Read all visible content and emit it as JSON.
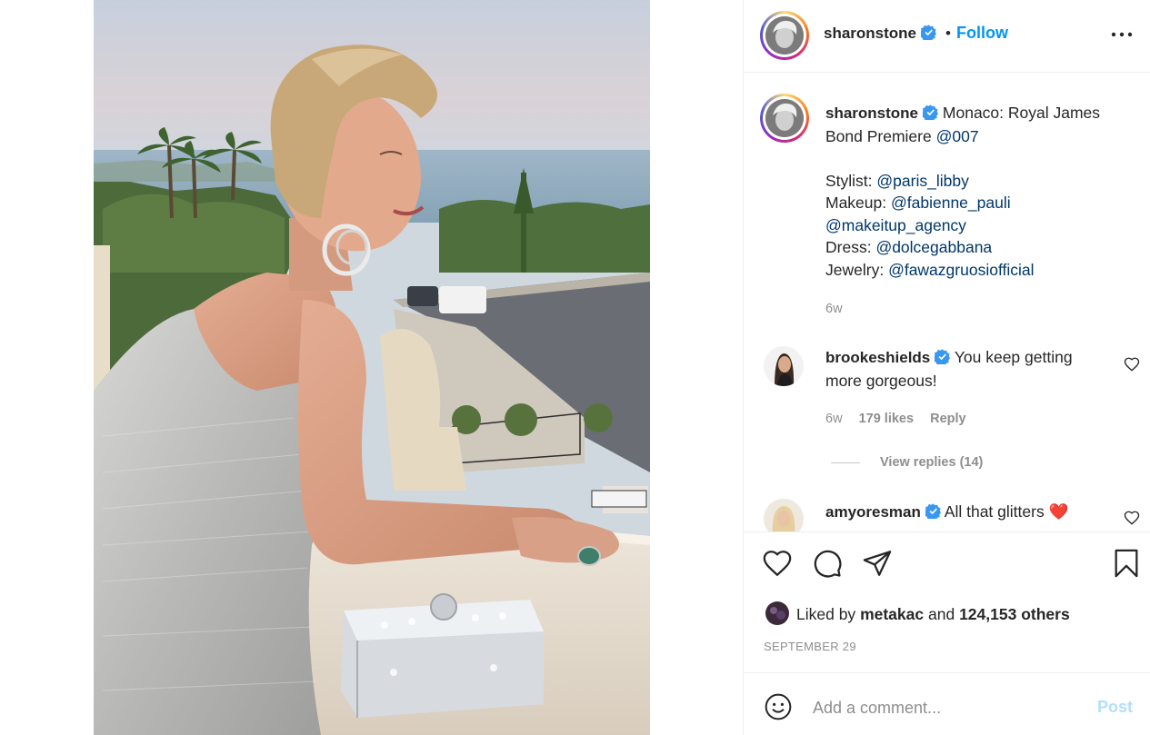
{
  "post": {
    "author": "sharonstone",
    "follow_label": "Follow",
    "separator": "•",
    "more_icon": "more-horizontal-icon",
    "caption": {
      "author": "sharonstone",
      "line1_text": "Monaco: Royal James",
      "line2_text": "Bond Premiere",
      "line2_mention": "@007",
      "credits": [
        {
          "label": "Stylist:",
          "mention": "@paris_libby"
        },
        {
          "label": "Makeup:",
          "mention": "@fabienne_pauli"
        },
        {
          "label": "",
          "mention": "@makeitup_agency"
        },
        {
          "label": "Dress:",
          "mention": "@dolcegabbana"
        },
        {
          "label": "Jewelry:",
          "mention": "@fawazgruosiofficial"
        }
      ],
      "age": "6w"
    },
    "comments": [
      {
        "author": "brookeshields",
        "text_line1": "You keep getting",
        "text_line2": "more gorgeous!",
        "age": "6w",
        "likes": "179 likes",
        "reply_label": "Reply",
        "view_replies": "View replies (14)"
      },
      {
        "author": "amyoresman",
        "text": "All that glitters",
        "emoji": "❤️"
      }
    ],
    "likes": {
      "prefix": "Liked by",
      "user": "metakac",
      "connector": "and",
      "others": "124,153 others"
    },
    "date": "SEPTEMBER 29",
    "comment_placeholder": "Add a comment...",
    "post_label": "Post"
  },
  "colors": {
    "link_blue": "#0095f6",
    "mention_blue": "#00376b",
    "verified_blue": "#3897f0",
    "muted": "#8e8e8e",
    "post_disabled": "#b2dffc"
  }
}
